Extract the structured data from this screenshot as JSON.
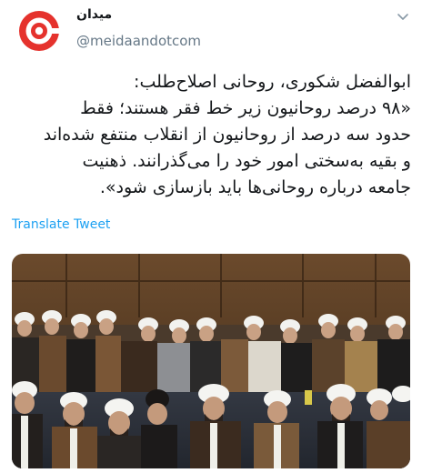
{
  "account": {
    "name": "میدان",
    "handle": "@meidaandotcom"
  },
  "tweet": {
    "lines": [
      "ابوالفضل شکوری، روحانی اصلاح‌طلب:",
      "«۹۸ درصد روحانیون زیر خط فقر هستند؛ فقط",
      "حدود سه درصد از روحانیون از انقلاب منتفع شده‌اند",
      "و بقیه به‌سختی امور خود را می‌گذرانند. ذهنیت",
      "جامعه درباره روحانی‌ها باید بازسازی شود»."
    ],
    "translate_label": "Translate Tweet"
  },
  "colors": {
    "brand_red": "#e5322d",
    "link_blue": "#1da1f2",
    "handle_gray": "#657786"
  },
  "icons": {
    "menu": "chevron-down-icon",
    "avatar": "meidaan-logo"
  }
}
